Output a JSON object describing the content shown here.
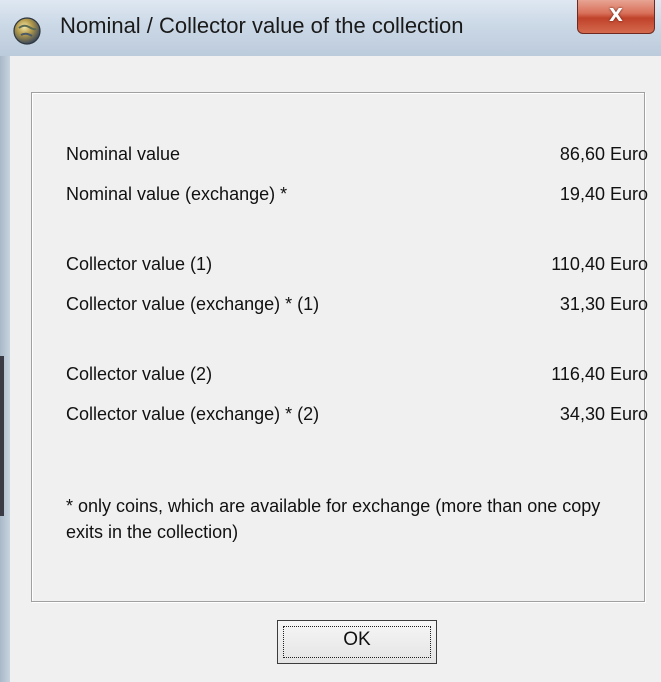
{
  "window": {
    "title": "Nominal / Collector value of the collection",
    "close_glyph": "X"
  },
  "values": {
    "rows": [
      {
        "label": "Nominal value",
        "value": "86,60 Euro"
      },
      {
        "label": "Nominal value (exchange) *",
        "value": "19,40 Euro"
      },
      {
        "label": "Collector value (1)",
        "value": "110,40 Euro"
      },
      {
        "label": "Collector value (exchange) * (1)",
        "value": "31,30 Euro"
      },
      {
        "label": "Collector value (2)",
        "value": "116,40 Euro"
      },
      {
        "label": "Collector value (exchange) * (2)",
        "value": "34,30 Euro"
      }
    ],
    "footnote": "* only coins, which are available for exchange (more than one copy exits in the collection)"
  },
  "buttons": {
    "ok_label": "OK"
  },
  "icons": {
    "app": "coin-globe-icon",
    "close": "close-icon"
  }
}
